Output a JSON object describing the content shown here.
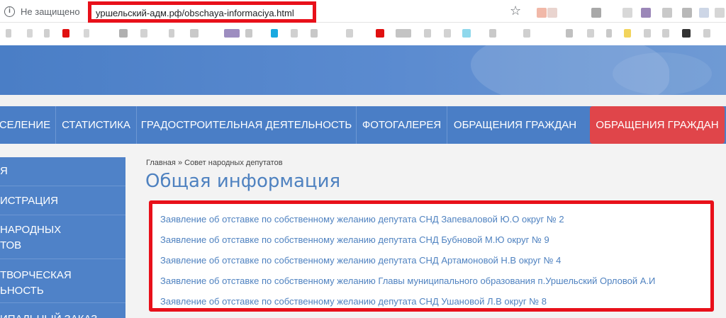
{
  "browser": {
    "security_label": "Не защищено",
    "url": "уршельский-адм.рф/obschaya-informaciya.html"
  },
  "nav": {
    "items": [
      "СЕЛЕНИЕ",
      "СТАТИСТИКА",
      "ГРАДОСТРОИТЕЛЬНАЯ ДЕЯТЕЛЬНОСТЬ",
      "ФОТОГАЛЕРЕЯ",
      "ОБРАЩЕНИЯ ГРАЖДАН",
      "ОБРАЩЕНИЯ ГРАЖДАН"
    ]
  },
  "sidebar": {
    "items": [
      {
        "line1": "Я",
        "line2": ""
      },
      {
        "line1": "ИСТРАЦИЯ",
        "line2": ""
      },
      {
        "line1": "НАРОДНЫХ",
        "line2": "ТОВ"
      },
      {
        "line1": "ТВОРЧЕСКАЯ",
        "line2": "ЬНОСТЬ"
      },
      {
        "line1": "ИПАЛЬНЫЙ ЗАКАЗ",
        "line2": ""
      }
    ]
  },
  "breadcrumb": {
    "home": "Главная",
    "separator": "»",
    "current": "Совет народных депутатов"
  },
  "page": {
    "title": "Общая информация"
  },
  "documents": [
    "Заявление об отставке по собственному желанию депутата СНД Запеваловой Ю.О  округ № 2",
    "Заявление об отставке по собственному желанию депутата СНД Бубновой М.Ю округ № 9",
    "Заявление об отставке по собственному желанию депутата СНД Артамоновой Н.В округ № 4",
    "Заявление об отставке по собственному желанию Главы муниципального образования п.Уршельский Орловой А.И",
    "Заявление об отставке по собственному желанию  депутата СНД Ушановой Л.В округ  № 8"
  ],
  "colors": {
    "nav_blue": "#4a7ec6",
    "highlight_red": "#e0454a",
    "annotation_red": "#e8101a",
    "link_blue": "#4f82c0"
  }
}
